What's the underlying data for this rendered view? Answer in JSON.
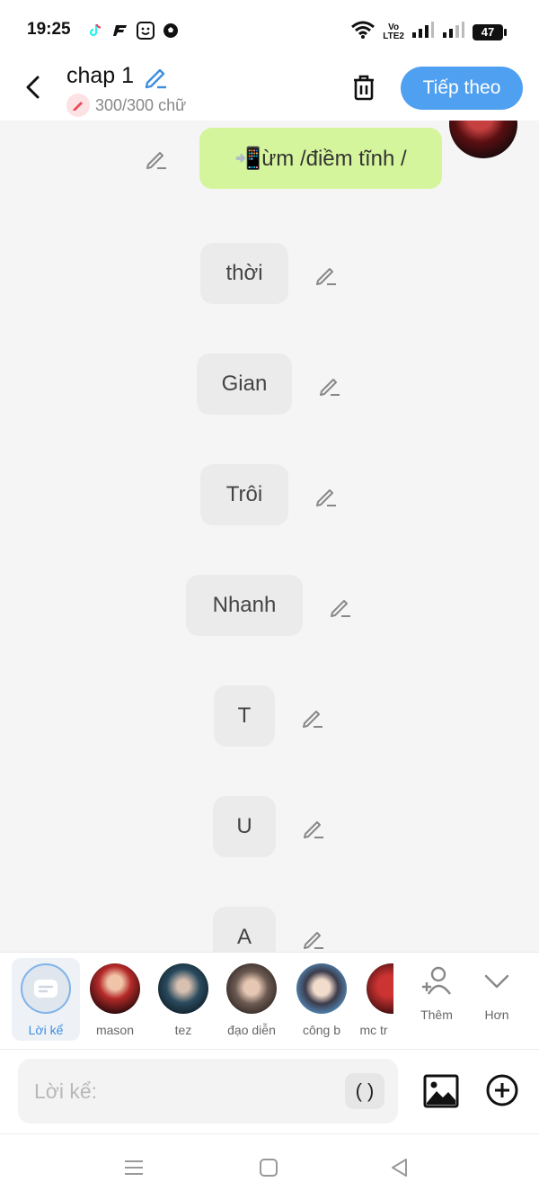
{
  "status_bar": {
    "time": "19:25",
    "volte_top": "Vo",
    "volte_bottom": "LTE2",
    "battery": "47"
  },
  "header": {
    "title": "chap 1",
    "char_count": "300/300 chữ",
    "next_label": "Tiếp theo"
  },
  "messages": [
    {
      "text": "📲ừm /điềm tĩnh /",
      "style": "green"
    },
    {
      "text": "thời"
    },
    {
      "text": "Gian"
    },
    {
      "text": "Trôi"
    },
    {
      "text": "Nhanh"
    },
    {
      "text": "T"
    },
    {
      "text": "U"
    },
    {
      "text": "A"
    }
  ],
  "characters": [
    {
      "name": "Lời kể",
      "selected": true
    },
    {
      "name": "mason"
    },
    {
      "name": "tez"
    },
    {
      "name": "đạo diễn"
    },
    {
      "name": "công b"
    },
    {
      "name": "mc tr"
    }
  ],
  "tools": {
    "add_label": "Thêm",
    "more_label": "Hơn"
  },
  "input": {
    "placeholder": "Lời kể:",
    "paren_label": "( )"
  },
  "colors": {
    "accent": "#4fa0f0",
    "green_bubble": "#d5f59c",
    "gray_bubble": "#ebebeb"
  }
}
